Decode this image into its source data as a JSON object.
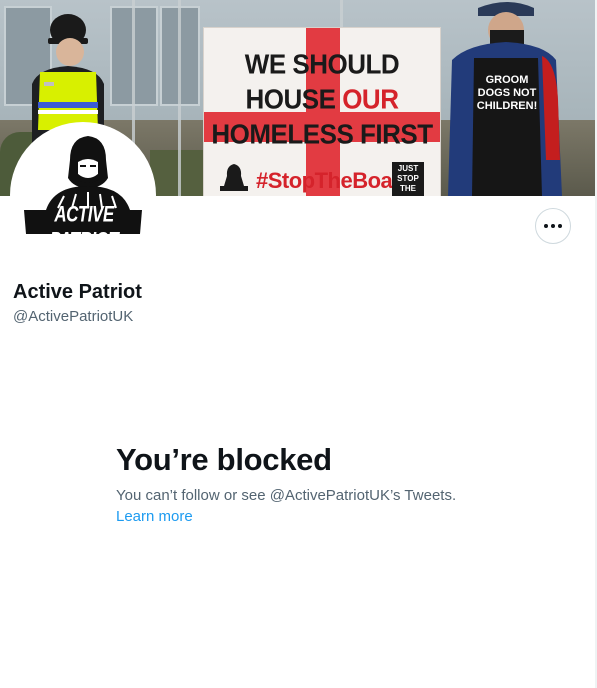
{
  "banner": {
    "sign_line1": "WE SHOULD",
    "sign_line2_a": "HOUSE ",
    "sign_line2_b": "OUR",
    "sign_line3": "HOMELESS FIRST",
    "hashtag": "#StopTheBoats",
    "just_stop": "JUST STOP THE",
    "protester_sign": "GROOM DOGS NOT CHILDREN!"
  },
  "avatar": {
    "logo_text": "ACTIVE PATRIOT"
  },
  "profile": {
    "name": "Active Patriot",
    "handle": "@ActivePatriotUK"
  },
  "actions": {
    "more_icon": "more-horizontal-icon"
  },
  "blocked": {
    "title": "You’re blocked",
    "message": "You can’t follow or see @ActivePatriotUK’s Tweets.",
    "learn_more": "Learn more"
  },
  "colors": {
    "text_primary": "#0f1419",
    "text_secondary": "#536471",
    "link": "#1d9bf0",
    "border": "#cfd9de"
  }
}
